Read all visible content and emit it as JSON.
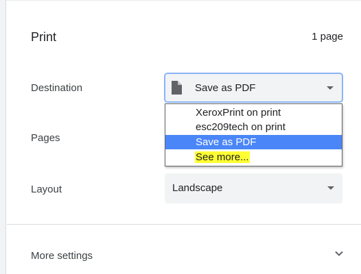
{
  "header": {
    "title": "Print",
    "page_count": "1 page"
  },
  "destination": {
    "label": "Destination",
    "selected_value": "Save as PDF",
    "icon": "document-icon",
    "options": [
      "XeroxPrint on print",
      "esc209tech on print",
      "Save as PDF",
      "See more..."
    ],
    "highlighted_option": "Save as PDF",
    "marker_highlight_option": "See more...",
    "marker_color": "#ffff33",
    "selected_color": "#4a86f7"
  },
  "pages": {
    "label": "Pages"
  },
  "layout": {
    "label": "Layout",
    "selected_value": "Landscape"
  },
  "more_settings": {
    "label": "More settings",
    "icon": "chevron-down-icon"
  }
}
